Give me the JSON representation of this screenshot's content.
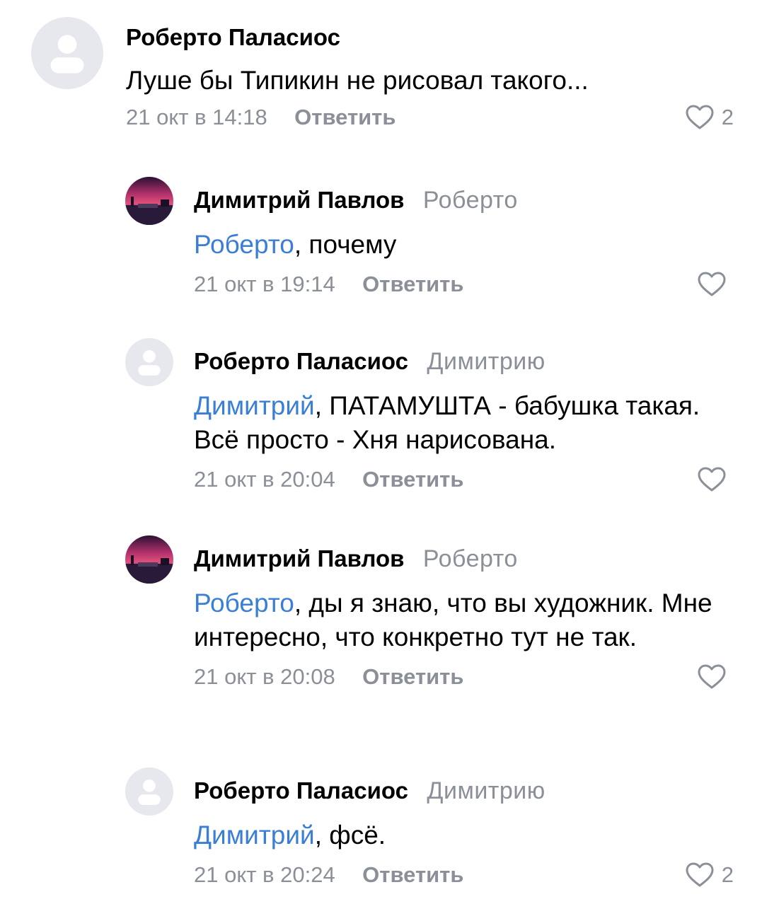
{
  "reply_label": "Ответить",
  "colors": {
    "meta_gray": "#8a8f98",
    "mention_blue": "#3a7fd5",
    "avatar_bg": "#e6e8ee"
  },
  "icons": {
    "like": "heart-outline-icon",
    "default_avatar": "user-silhouette-icon"
  },
  "comments": [
    {
      "author": "Роберто Паласиос",
      "reply_to": "",
      "mention": "",
      "text": "Луше бы Типикин не рисовал такого...",
      "time": "21 окт в 14:18",
      "likes": "2"
    },
    {
      "author": "Димитрий Павлов",
      "reply_to": "Роберто",
      "mention": "Роберто",
      "text": ", почему",
      "time": "21 окт в 19:14",
      "likes": ""
    },
    {
      "author": "Роберто Паласиос",
      "reply_to": "Димитрию",
      "mention": "Димитрий",
      "text": ", ПАТАМУШТА - бабушка такая. Всё просто - Хня нарисована.",
      "time": "21 окт в 20:04",
      "likes": ""
    },
    {
      "author": "Димитрий Павлов",
      "reply_to": "Роберто",
      "mention": "Роберто",
      "text": ", ды я знаю, что вы художник. Мне интересно, что конкретно тут не так.",
      "time": "21 окт в 20:08",
      "likes": ""
    },
    {
      "author": "Роберто Паласиос",
      "reply_to": "Димитрию",
      "mention": "Димитрий",
      "text": ", фсё.",
      "time": "21 окт в 20:24",
      "likes": "2"
    }
  ]
}
